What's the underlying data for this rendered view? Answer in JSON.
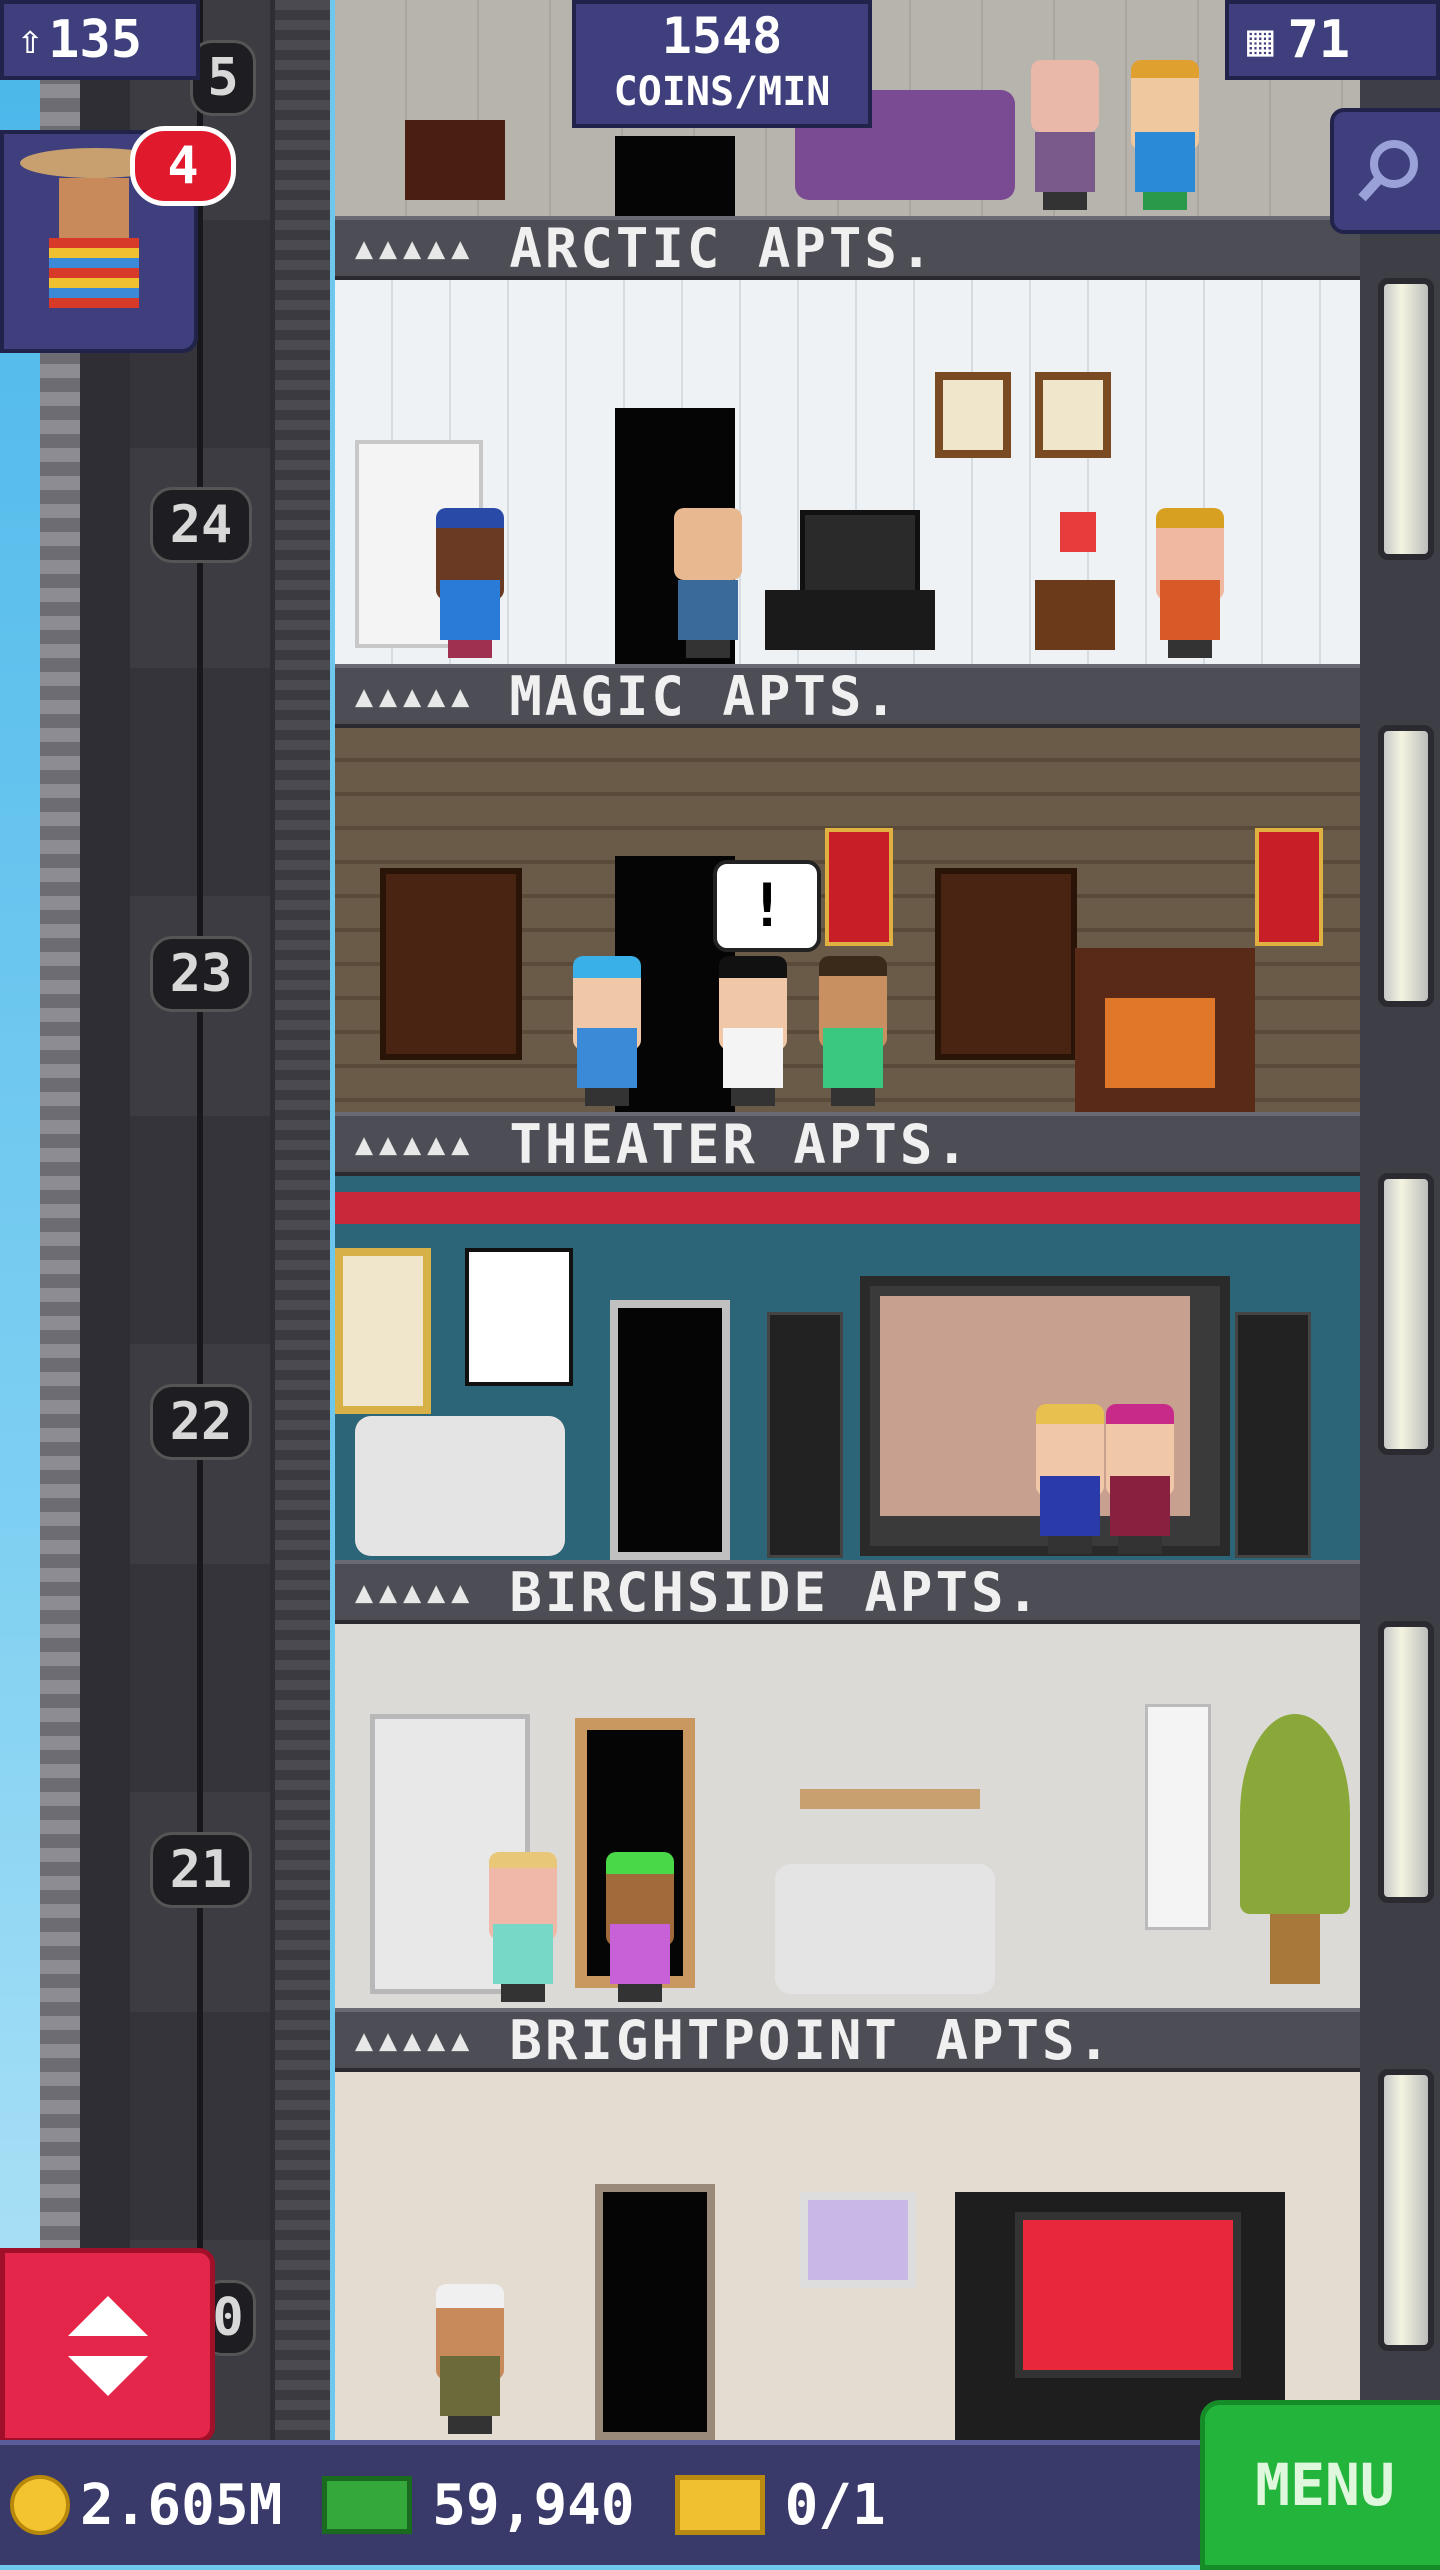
{
  "hud": {
    "population": "135",
    "coins_per_min_value": "1548",
    "coins_per_min_label": "COINS/MIN",
    "floor_count": "71",
    "visitor_badge": "4"
  },
  "shaft_floor_numbers": [
    "5",
    "24",
    "23",
    "22",
    "21",
    "0"
  ],
  "floors": [
    {
      "name": "ARCTIC APTS.",
      "stars": "▲▲▲▲▲"
    },
    {
      "name": "MAGIC APTS.",
      "stars": "▲▲▲▲▲"
    },
    {
      "name": "THEATER APTS.",
      "stars": "▲▲▲▲▲"
    },
    {
      "name": "BIRCHSIDE APTS.",
      "stars": "▲▲▲▲▲"
    },
    {
      "name": "BRIGHTPOINT APTS.",
      "stars": "▲▲▲▲▲"
    }
  ],
  "speech_bubble": "!",
  "bottom_bar": {
    "coins": "2.605M",
    "bux": "59,940",
    "tickets": "0/1",
    "menu_label": "MENU"
  },
  "icons": {
    "population": "person-up-icon",
    "floors": "building-icon",
    "search": "magnifier-icon",
    "elevator": "up-down-arrows-icon",
    "coins": "coin-icon",
    "bux": "banknote-icon",
    "tickets": "ticket-icon"
  },
  "colors": {
    "hud_bg": "#3e3f7c",
    "menu_green": "#23b43c",
    "elevator_red": "#e4264a",
    "badge_red": "#e01a2c"
  }
}
